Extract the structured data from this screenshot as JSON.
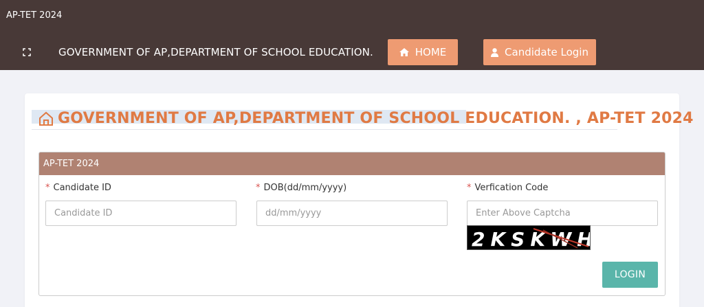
{
  "header": {
    "app_title": "AP-TET 2024",
    "department": "GOVERNMENT OF AP,DEPARTMENT OF SCHOOL EDUCATION.",
    "expand_icon": "fullscreen-icon",
    "nav": {
      "home_label": "HOME",
      "home_icon": "home-icon",
      "candidate_login_label": "Candidate Login",
      "candidate_login_icon": "user-icon"
    }
  },
  "main": {
    "heading": "GOVERNMENT OF AP,DEPARTMENT OF SCHOOL EDUCATION. , AP-TET 2024",
    "heading_icon": "bank-building-icon",
    "panel": {
      "title": "AP-TET 2024",
      "fields": [
        {
          "required_mark": "*",
          "label": "Candidate ID",
          "placeholder": "Candidate ID",
          "value": ""
        },
        {
          "required_mark": "*",
          "label": "DOB(dd/mm/yyyy)",
          "placeholder": "dd/mm/yyyy",
          "value": ""
        },
        {
          "required_mark": "*",
          "label": "Verfication Code",
          "placeholder": "Enter Above Captcha",
          "value": ""
        }
      ],
      "captcha_text": "2KSKWH",
      "login_label": "LOGIN"
    }
  },
  "colors": {
    "topbar": "#483937",
    "nav_button": "#ee9b72",
    "heading": "#e07a44",
    "panel_header": "#b08272",
    "login_button": "#5ab5aa",
    "required": "#d9534f"
  }
}
